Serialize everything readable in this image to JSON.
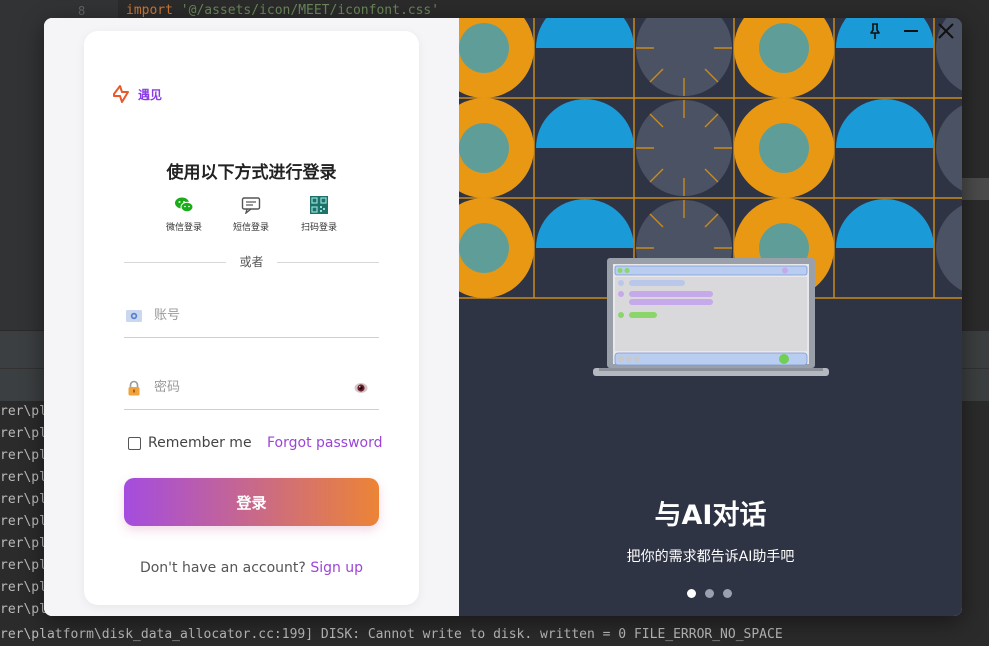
{
  "ide": {
    "line_number": "8",
    "code_keyword": "import",
    "code_string": "'@/assets/icon/MEET/iconfont.css'",
    "console_lines": [
      "rer\\pl",
      "rer\\pl",
      "rer\\pl",
      "rer\\pl",
      "rer\\pl",
      "rer\\pl",
      "rer\\pl",
      "rer\\pl",
      "rer\\pl",
      "rer\\pl",
      "rer\\platform\\disk_data_allocator.cc:199] DISK: Cannot write to disk. written = 0 FILE_ERROR_NO_SPACE"
    ]
  },
  "brand": {
    "name": "遇见",
    "accent": "#8a3ce6"
  },
  "login": {
    "title": "使用以下方式进行登录",
    "methods": [
      {
        "label": "微信登录",
        "icon": "wechat-icon"
      },
      {
        "label": "短信登录",
        "icon": "sms-icon"
      },
      {
        "label": "扫码登录",
        "icon": "qr-code-icon"
      }
    ],
    "divider": "或者",
    "account_placeholder": "账号",
    "password_placeholder": "密码",
    "remember_label": "Remember me",
    "forgot_label": "Forgot password",
    "submit_label": "登录",
    "signup_prompt": "Don't have an account?",
    "signup_link": "Sign up"
  },
  "slide": {
    "title": "与AI对话",
    "subtitle": "把你的需求都告诉AI助手吧",
    "dots_total": 3,
    "active_dot": 1
  },
  "window_controls": [
    "pin-icon",
    "minimize-icon",
    "close-icon"
  ],
  "colors": {
    "button_gradient_start": "#a44ce0",
    "button_gradient_end": "#ec8436",
    "link": "#9b45d8",
    "right_bg": "#2f3445"
  }
}
